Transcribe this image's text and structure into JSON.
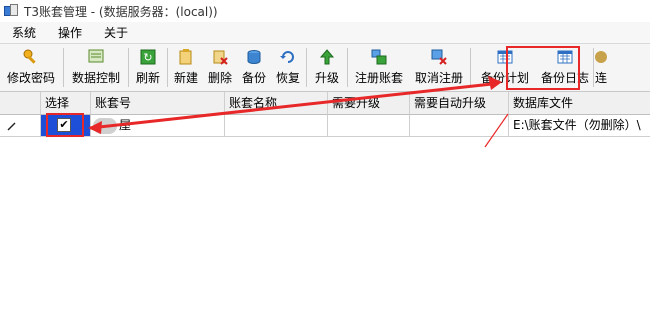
{
  "window": {
    "title": "T3账套管理 -  (数据服务器：(local))"
  },
  "menu": [
    "系统",
    "操作",
    "关于"
  ],
  "toolbar": {
    "buttons": [
      {
        "label": "修改密码",
        "icon": "key-icon"
      },
      {
        "label": "数据控制",
        "icon": "data-control-icon"
      },
      {
        "label": "刷新",
        "icon": "refresh-icon"
      },
      {
        "label": "新建",
        "icon": "new-icon"
      },
      {
        "label": "删除",
        "icon": "delete-icon"
      },
      {
        "label": "备份",
        "icon": "backup-icon"
      },
      {
        "label": "恢复",
        "icon": "restore-icon"
      },
      {
        "label": "升级",
        "icon": "upgrade-icon"
      },
      {
        "label": "注册账套",
        "icon": "register-icon"
      },
      {
        "label": "取消注册",
        "icon": "unregister-icon"
      },
      {
        "label": "备份计划",
        "icon": "backup-plan-icon"
      },
      {
        "label": "备份日志",
        "icon": "backup-log-icon"
      },
      {
        "label": "连",
        "icon": "connect-icon"
      }
    ]
  },
  "table": {
    "columns": [
      "选择",
      "账套号",
      "账套名称",
      "需要升级",
      "需要自动升级",
      "数据库文件"
    ],
    "rows": [
      {
        "selected": "✔",
        "account_no": "屋",
        "account_name": "",
        "needs_upgrade": "",
        "needs_auto_upgrade": "",
        "db_file": "E:\\账套文件（勿删除）\\"
      }
    ]
  },
  "colors": {
    "accent_red": "#e82828",
    "selected_cell": "#1e4fd8",
    "row_marker": "#222222"
  }
}
